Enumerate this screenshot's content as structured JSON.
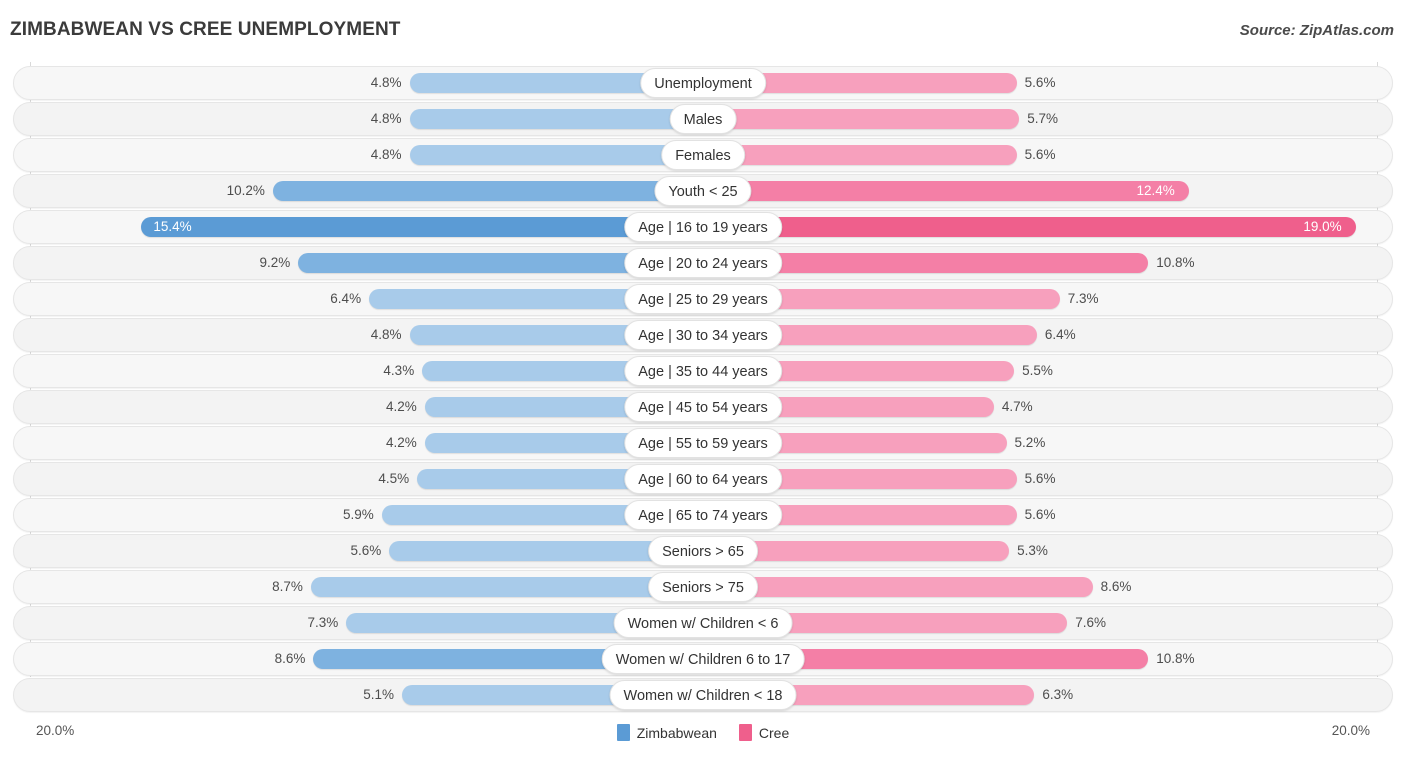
{
  "header": {
    "title": "ZIMBABWEAN VS CREE UNEMPLOYMENT",
    "source": "Source: ZipAtlas.com"
  },
  "axis": {
    "left_label": "20.0%",
    "right_label": "20.0%",
    "max": 20.0
  },
  "legend": [
    {
      "label": "Zimbabwean",
      "color": "#5b9bd5"
    },
    {
      "label": "Cree",
      "color": "#ef5f8c"
    }
  ],
  "colors": {
    "left_light": "#a8cbea",
    "left_mid": "#7eb2e0",
    "left_dark": "#5b9bd5",
    "right_light": "#f7a0bd",
    "right_mid": "#f47fa6",
    "right_dark": "#ef5f8c",
    "track": "#f7f7f7",
    "gridline": "#d9d9d9"
  },
  "chart_data": {
    "type": "bar",
    "title": "ZIMBABWEAN VS CREE UNEMPLOYMENT",
    "subtitle": "",
    "xlabel": "",
    "ylabel": "",
    "orientation": "horizontal-diverging",
    "grid": true,
    "legend_position": "bottom-center",
    "xlim": [
      20.0,
      20.0
    ],
    "categories": [
      "Unemployment",
      "Males",
      "Females",
      "Youth < 25",
      "Age | 16 to 19 years",
      "Age | 20 to 24 years",
      "Age | 25 to 29 years",
      "Age | 30 to 34 years",
      "Age | 35 to 44 years",
      "Age | 45 to 54 years",
      "Age | 55 to 59 years",
      "Age | 60 to 64 years",
      "Age | 65 to 74 years",
      "Seniors > 65",
      "Seniors > 75",
      "Women w/ Children < 6",
      "Women w/ Children 6 to 17",
      "Women w/ Children < 18"
    ],
    "series": [
      {
        "name": "Zimbabwean",
        "side": "left",
        "values": [
          4.8,
          4.8,
          4.8,
          10.2,
          15.4,
          9.2,
          6.4,
          4.8,
          4.3,
          4.2,
          4.2,
          4.5,
          5.9,
          5.6,
          8.7,
          7.3,
          8.6,
          5.1
        ],
        "labels": [
          "4.8%",
          "4.8%",
          "4.8%",
          "10.2%",
          "15.4%",
          "9.2%",
          "6.4%",
          "4.8%",
          "4.3%",
          "4.2%",
          "4.2%",
          "4.5%",
          "5.9%",
          "5.6%",
          "8.7%",
          "7.3%",
          "8.6%",
          "5.1%"
        ]
      },
      {
        "name": "Cree",
        "side": "right",
        "values": [
          5.6,
          5.7,
          5.6,
          12.4,
          19.0,
          10.8,
          7.3,
          6.4,
          5.5,
          4.7,
          5.2,
          5.6,
          5.6,
          5.3,
          8.6,
          7.6,
          10.8,
          6.3
        ],
        "labels": [
          "5.6%",
          "5.7%",
          "5.6%",
          "12.4%",
          "19.0%",
          "10.8%",
          "7.3%",
          "6.4%",
          "5.5%",
          "4.7%",
          "5.2%",
          "5.6%",
          "5.6%",
          "5.3%",
          "8.6%",
          "7.6%",
          "10.8%",
          "6.3%"
        ]
      }
    ]
  },
  "rows": [
    {
      "category": "Unemployment",
      "left_label": "4.8%",
      "right_label": "5.6%",
      "left_value": 4.8,
      "right_value": 5.6,
      "left_inside": false,
      "right_inside": false,
      "emphasis": 0
    },
    {
      "category": "Males",
      "left_label": "4.8%",
      "right_label": "5.7%",
      "left_value": 4.8,
      "right_value": 5.7,
      "left_inside": false,
      "right_inside": false,
      "emphasis": 0
    },
    {
      "category": "Females",
      "left_label": "4.8%",
      "right_label": "5.6%",
      "left_value": 4.8,
      "right_value": 5.6,
      "left_inside": false,
      "right_inside": false,
      "emphasis": 0
    },
    {
      "category": "Youth < 25",
      "left_label": "10.2%",
      "right_label": "12.4%",
      "left_value": 10.2,
      "right_value": 12.4,
      "left_inside": false,
      "right_inside": true,
      "emphasis": 1
    },
    {
      "category": "Age | 16 to 19 years",
      "left_label": "15.4%",
      "right_label": "19.0%",
      "left_value": 15.4,
      "right_value": 19.0,
      "left_inside": true,
      "right_inside": true,
      "emphasis": 2
    },
    {
      "category": "Age | 20 to 24 years",
      "left_label": "9.2%",
      "right_label": "10.8%",
      "left_value": 9.2,
      "right_value": 10.8,
      "left_inside": false,
      "right_inside": false,
      "emphasis": 1
    },
    {
      "category": "Age | 25 to 29 years",
      "left_label": "6.4%",
      "right_label": "7.3%",
      "left_value": 6.4,
      "right_value": 7.3,
      "left_inside": false,
      "right_inside": false,
      "emphasis": 0
    },
    {
      "category": "Age | 30 to 34 years",
      "left_label": "4.8%",
      "right_label": "6.4%",
      "left_value": 4.8,
      "right_value": 6.4,
      "left_inside": false,
      "right_inside": false,
      "emphasis": 0
    },
    {
      "category": "Age | 35 to 44 years",
      "left_label": "4.3%",
      "right_label": "5.5%",
      "left_value": 4.3,
      "right_value": 5.5,
      "left_inside": false,
      "right_inside": false,
      "emphasis": 0
    },
    {
      "category": "Age | 45 to 54 years",
      "left_label": "4.2%",
      "right_label": "4.7%",
      "left_value": 4.2,
      "right_value": 4.7,
      "left_inside": false,
      "right_inside": false,
      "emphasis": 0
    },
    {
      "category": "Age | 55 to 59 years",
      "left_label": "4.2%",
      "right_label": "5.2%",
      "left_value": 4.2,
      "right_value": 5.2,
      "left_inside": false,
      "right_inside": false,
      "emphasis": 0
    },
    {
      "category": "Age | 60 to 64 years",
      "left_label": "4.5%",
      "right_label": "5.6%",
      "left_value": 4.5,
      "right_value": 5.6,
      "left_inside": false,
      "right_inside": false,
      "emphasis": 0
    },
    {
      "category": "Age | 65 to 74 years",
      "left_label": "5.9%",
      "right_label": "5.6%",
      "left_value": 5.9,
      "right_value": 5.6,
      "left_inside": false,
      "right_inside": false,
      "emphasis": 0
    },
    {
      "category": "Seniors > 65",
      "left_label": "5.6%",
      "right_label": "5.3%",
      "left_value": 5.6,
      "right_value": 5.3,
      "left_inside": false,
      "right_inside": false,
      "emphasis": 0
    },
    {
      "category": "Seniors > 75",
      "left_label": "8.7%",
      "right_label": "8.6%",
      "left_value": 8.7,
      "right_value": 8.6,
      "left_inside": false,
      "right_inside": false,
      "emphasis": 0
    },
    {
      "category": "Women w/ Children < 6",
      "left_label": "7.3%",
      "right_label": "7.6%",
      "left_value": 7.3,
      "right_value": 7.6,
      "left_inside": false,
      "right_inside": false,
      "emphasis": 0
    },
    {
      "category": "Women w/ Children 6 to 17",
      "left_label": "8.6%",
      "right_label": "10.8%",
      "left_value": 8.6,
      "right_value": 10.8,
      "left_inside": false,
      "right_inside": false,
      "emphasis": 1
    },
    {
      "category": "Women w/ Children < 18",
      "left_label": "5.1%",
      "right_label": "6.3%",
      "left_value": 5.1,
      "right_value": 6.3,
      "left_inside": false,
      "right_inside": false,
      "emphasis": 0
    }
  ]
}
